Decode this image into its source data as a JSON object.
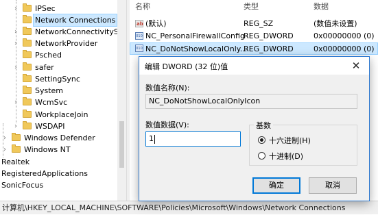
{
  "tree": {
    "items": [
      {
        "label": "IPSec",
        "expander": "›"
      },
      {
        "label": "Network Connections",
        "expander": "",
        "selected": true
      },
      {
        "label": "NetworkConnectivityStat",
        "expander": "›"
      },
      {
        "label": "NetworkProvider",
        "expander": "›"
      },
      {
        "label": "Psched",
        "expander": ""
      },
      {
        "label": "safer",
        "expander": "›"
      },
      {
        "label": "SettingSync",
        "expander": ""
      },
      {
        "label": "System",
        "expander": ""
      },
      {
        "label": "WcmSvc",
        "expander": "›"
      },
      {
        "label": "WorkplaceJoin",
        "expander": ""
      },
      {
        "label": "WSDAPI",
        "expander": "›"
      },
      {
        "label": "Windows Defender",
        "expander": "›"
      },
      {
        "label": "Windows NT",
        "expander": "›"
      },
      {
        "label": "Realtek",
        "expander": ""
      },
      {
        "label": "RegisteredApplications",
        "expander": ""
      },
      {
        "label": "SonicFocus",
        "expander": ""
      }
    ]
  },
  "list": {
    "columns": {
      "name": "名称",
      "type": "类型",
      "data": "数据"
    },
    "rows": [
      {
        "icon": "string-value-icon",
        "name": "(默认)",
        "type": "REG_SZ",
        "data": "(数值未设置)"
      },
      {
        "icon": "dword-value-icon",
        "name": "NC_PersonalFirewallConfig",
        "type": "REG_DWORD",
        "data": "0x00000000 (0)"
      },
      {
        "icon": "dword-value-icon",
        "name": "NC_DoNotShowLocalOnly...",
        "type": "REG_DWORD",
        "data": "0x00000000 (0)"
      }
    ]
  },
  "status": {
    "path": "计算机\\HKEY_LOCAL_MACHINE\\SOFTWARE\\Policies\\Microsoft\\Windows\\Network Connections"
  },
  "dialog": {
    "title": "编辑 DWORD (32 位)值",
    "close_glyph": "✕",
    "name_label": "数值名称(N):",
    "name_value": "NC_DoNotShowLocalOnlyIcon",
    "data_label": "数值数据(V):",
    "data_value": "1",
    "base_label": "基数",
    "hex_label": "十六进制(H)",
    "dec_label": "十进制(D)",
    "base_selected": "hex",
    "ok_label": "确定",
    "cancel_label": "取消"
  },
  "colors": {
    "selection": "#cce8ff",
    "accent": "#0078d7",
    "folder": "#f0c85a"
  }
}
